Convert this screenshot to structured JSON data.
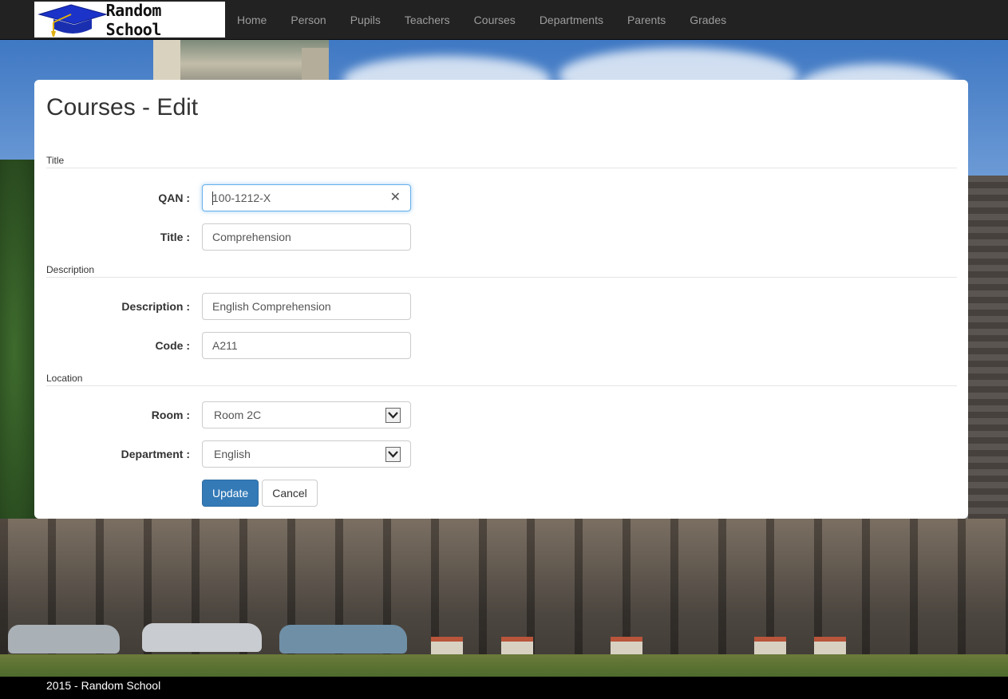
{
  "brand": {
    "name": "Random School",
    "icon": "graduation-cap-icon"
  },
  "nav": {
    "items": [
      {
        "label": "Home"
      },
      {
        "label": "Person"
      },
      {
        "label": "Pupils"
      },
      {
        "label": "Teachers"
      },
      {
        "label": "Courses"
      },
      {
        "label": "Departments"
      },
      {
        "label": "Parents"
      },
      {
        "label": "Grades"
      }
    ]
  },
  "page": {
    "title": "Courses - Edit"
  },
  "form": {
    "sections": {
      "title": "Title",
      "description": "Description",
      "location": "Location"
    },
    "qan": {
      "label": "QAN :",
      "value": "100-1212-X"
    },
    "title": {
      "label": "Title :",
      "value": "Comprehension"
    },
    "description": {
      "label": "Description :",
      "value": "English Comprehension"
    },
    "code": {
      "label": "Code :",
      "value": "A211"
    },
    "room": {
      "label": "Room :",
      "selected": "Room 2C"
    },
    "department": {
      "label": "Department :",
      "selected": "English"
    },
    "buttons": {
      "update": "Update",
      "cancel": "Cancel"
    }
  },
  "footer": {
    "text": "2015 - Random School"
  },
  "colors": {
    "navbar": "#222222",
    "primary": "#337ab7",
    "focus": "#66afe9",
    "footer": "#000000"
  }
}
